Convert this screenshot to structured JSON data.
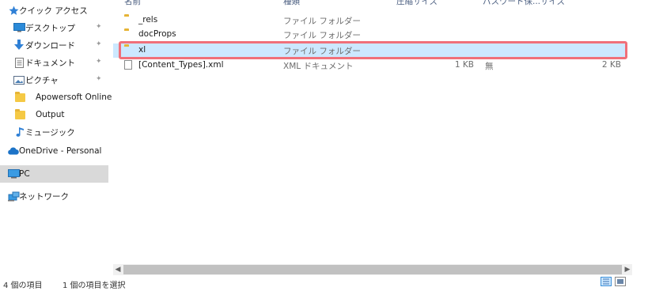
{
  "nav": {
    "items": [
      {
        "label": "クイック アクセス",
        "icon": "star-icon",
        "pinned": false
      },
      {
        "label": "デスクトップ",
        "icon": "desktop-icon",
        "pinned": true
      },
      {
        "label": "ダウンロード",
        "icon": "download-arrow-icon",
        "pinned": true
      },
      {
        "label": "ドキュメント",
        "icon": "document-icon",
        "pinned": true
      },
      {
        "label": "ピクチャ",
        "icon": "picture-icon",
        "pinned": true
      },
      {
        "label": "Apowersoft Online",
        "icon": "folder-icon",
        "pinned": false
      },
      {
        "label": "Output",
        "icon": "folder-icon",
        "pinned": false
      },
      {
        "label": "ミュージック",
        "icon": "music-note-icon",
        "pinned": false
      },
      {
        "label": "OneDrive - Personal",
        "icon": "cloud-icon",
        "pinned": false
      },
      {
        "label": "PC",
        "icon": "pc-icon",
        "pinned": false,
        "selected": true
      },
      {
        "label": "ネットワーク",
        "icon": "network-icon",
        "pinned": false
      }
    ]
  },
  "columns": {
    "name": "名前",
    "type": "種類",
    "compressed": "圧縮サイズ",
    "password": "パスワード保...",
    "size": "サイズ"
  },
  "files": [
    {
      "name": "_rels",
      "type": "ファイル フォルダー",
      "compressed": "",
      "password": "",
      "size": "",
      "icon": "folder-icon"
    },
    {
      "name": "docProps",
      "type": "ファイル フォルダー",
      "compressed": "",
      "password": "",
      "size": "",
      "icon": "folder-icon"
    },
    {
      "name": "xl",
      "type": "ファイル フォルダー",
      "compressed": "",
      "password": "",
      "size": "",
      "icon": "folder-icon",
      "selected": true
    },
    {
      "name": "[Content_Types].xml",
      "type": "XML ドキュメント",
      "compressed": "1 KB",
      "password": "無",
      "size": "2 KB",
      "icon": "xml-file-icon"
    }
  ],
  "status": {
    "count": "4 個の項目",
    "selected": "1 個の項目を選択"
  },
  "colors": {
    "selection": "#cce8ff",
    "highlight_border": "#f0707a",
    "nav_selected": "#d9d9d9"
  }
}
